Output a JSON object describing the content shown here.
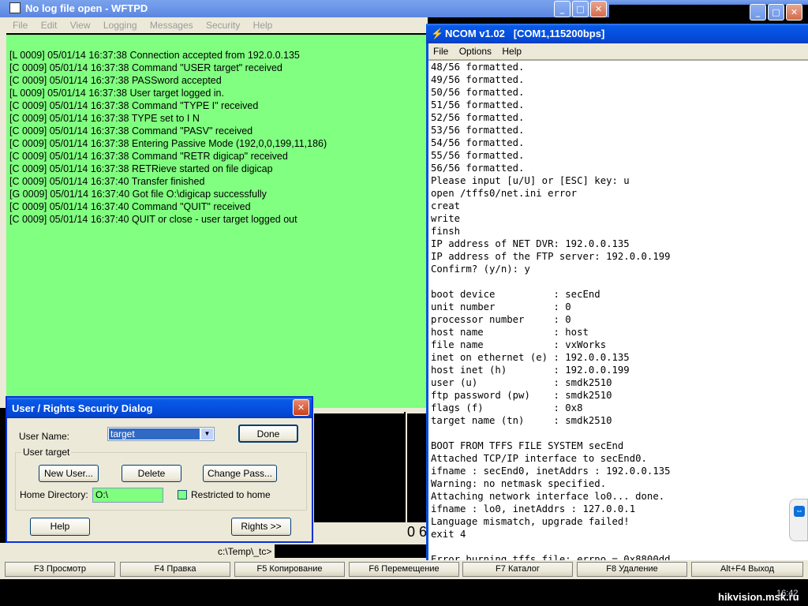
{
  "wftpd": {
    "title": "No log file open - WFTPD",
    "menu": [
      "File",
      "Edit",
      "View",
      "Logging",
      "Messages",
      "Security",
      "Help"
    ],
    "log_lines": [
      "[L 0009] 05/01/14 16:37:38 Connection accepted from 192.0.0.135",
      "[C 0009] 05/01/14 16:37:38 Command \"USER target\" received",
      "[C 0009] 05/01/14 16:37:38 PASSword accepted",
      "[L 0009] 05/01/14 16:37:38 User target logged in.",
      "[C 0009] 05/01/14 16:37:38 Command \"TYPE I\" received",
      "[C 0009] 05/01/14 16:37:38 TYPE set to I N",
      "[C 0009] 05/01/14 16:37:38 Command \"PASV\" received",
      "[C 0009] 05/01/14 16:37:38 Entering Passive Mode (192,0,0,199,11,186)",
      "[C 0009] 05/01/14 16:37:38 Command \"RETR digicap\" received",
      "[C 0009] 05/01/14 16:37:38 RETRieve started on file digicap",
      "[C 0009] 05/01/14 16:37:40 Transfer finished",
      "[G 0009] 05/01/14 16:37:40 Got file O:\\digicap successfully",
      "[C 0009] 05/01/14 16:37:40 Command \"QUIT\" received",
      "[C 0009] 05/01/14 16:37:40 QUIT or close - user target logged out"
    ]
  },
  "ncom": {
    "title": "NCOM v1.02   [COM1,115200bps]",
    "menu": [
      "File",
      "Options",
      "Help"
    ],
    "lines": [
      "48/56 formatted.",
      "49/56 formatted.",
      "50/56 formatted.",
      "51/56 formatted.",
      "52/56 formatted.",
      "53/56 formatted.",
      "54/56 formatted.",
      "55/56 formatted.",
      "56/56 formatted.",
      "Please input [u/U] or [ESC] key: u",
      "open /tffs0/net.ini error",
      "creat",
      "write",
      "finsh",
      "IP address of NET DVR: 192.0.0.135",
      "IP address of the FTP server: 192.0.0.199",
      "Confirm? (y/n): y",
      "",
      "boot device          : secEnd",
      "unit number          : 0",
      "processor number     : 0",
      "host name            : host",
      "file name            : vxWorks",
      "inet on ethernet (e) : 192.0.0.135",
      "host inet (h)        : 192.0.0.199",
      "user (u)             : smdk2510",
      "ftp password (pw)    : smdk2510",
      "flags (f)            : 0x8",
      "target name (tn)     : smdk2510",
      "",
      "BOOT FROM TFFS FILE SYSTEM secEnd",
      "Attached TCP/IP interface to secEnd0.",
      "ifname : secEnd0, inetAddrs : 192.0.0.135",
      "Warning: no netmask specified.",
      "Attaching network interface lo0... done.",
      "ifname : lo0, inetAddrs : 127.0.0.1",
      "Language mismatch, upgrade failed!",
      "exit 4",
      "",
      "Error burning tffs file: errno = 0x8800dd."
    ]
  },
  "dialog": {
    "title": "User / Rights Security Dialog",
    "username_label": "User Name:",
    "username_value": "target",
    "done_label": "Done",
    "group_label": "User target",
    "new_user_label": "New User...",
    "delete_label": "Delete",
    "change_pass_label": "Change Pass...",
    "home_dir_label": "Home Directory:",
    "home_dir_value": "O:\\",
    "restricted_label": "Restricted to home",
    "help_label": "Help",
    "rights_label": "Rights >>"
  },
  "commander": {
    "path": "c:\\Temp\\_tc>",
    "partial_number": "0 6",
    "fkeys": [
      "F3 Просмотр",
      "F4 Правка",
      "F5 Копирование",
      "F6 Перемещение",
      "F7 Каталог",
      "F8 Удаление",
      "Alt+F4 Выход"
    ]
  },
  "taskbar": {
    "clock": "16:42",
    "watermark": "hikvision.msk.ru"
  },
  "colors": {
    "log_bg": "#80ff80",
    "xp_title": "#0550e0",
    "dialog_face": "#ece9d8"
  }
}
